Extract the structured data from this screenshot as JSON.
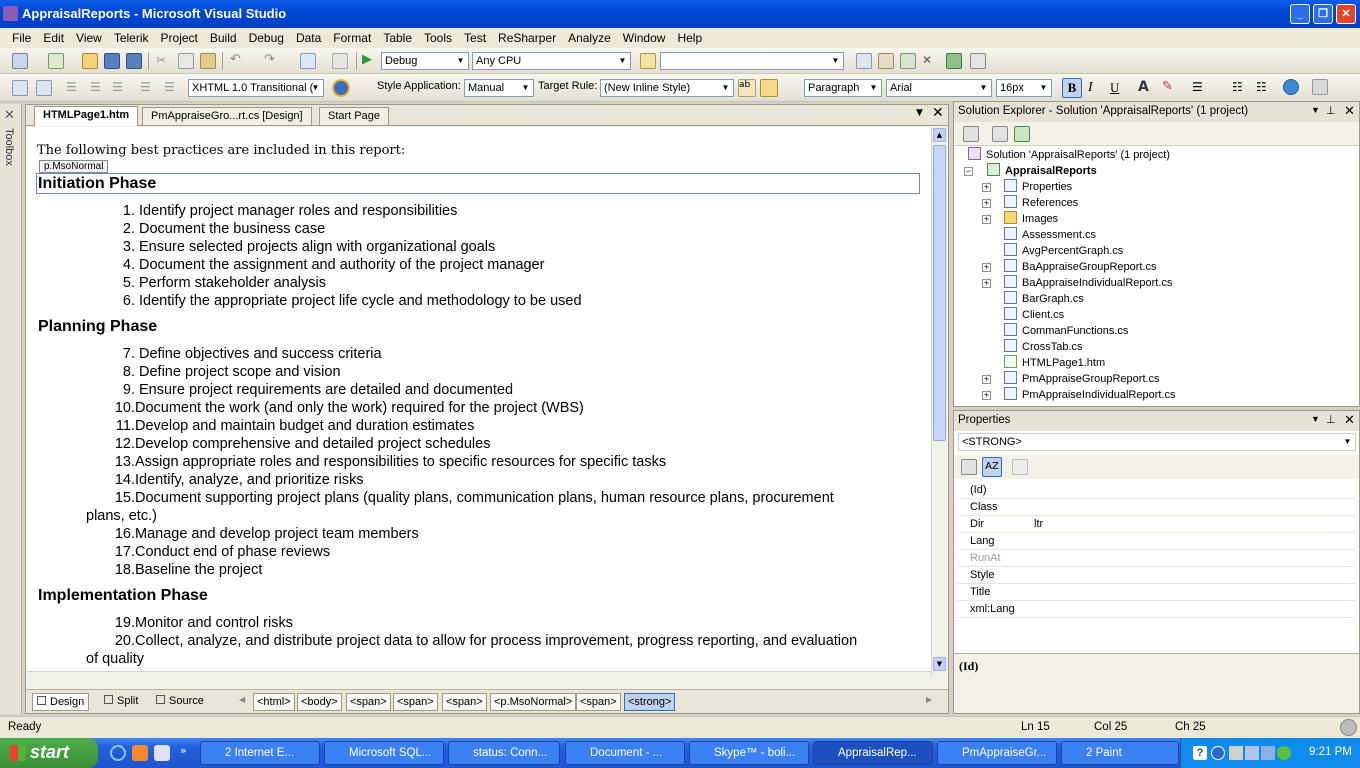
{
  "window": {
    "title": "AppraisalReports - Microsoft Visual Studio"
  },
  "menu": [
    "File",
    "Edit",
    "View",
    "Telerik",
    "Project",
    "Build",
    "Debug",
    "Data",
    "Format",
    "Table",
    "Tools",
    "Test",
    "ReSharper",
    "Analyze",
    "Window",
    "Help"
  ],
  "toolbar1": {
    "config": "Debug",
    "platform": "Any CPU",
    "find": ""
  },
  "toolbar2": {
    "doctype": "XHTML 1.0 Transitional (",
    "style_app_label": "Style Application:",
    "style_app_value": "Manual",
    "target_rule_label": "Target Rule:",
    "target_rule_value": "(New Inline Style)",
    "block_format": "Paragraph",
    "font_name": "Arial",
    "font_size": "16px"
  },
  "toolbox_label": "Toolbox",
  "tabs": [
    "HTMLPage1.htm",
    "PmAppraiseGro...rt.cs [Design]",
    "Start Page"
  ],
  "editor": {
    "intro": "The following best practices are included in this report:",
    "tag_hint": "p.MsoNormal",
    "sections": [
      {
        "heading": "Initiation Phase",
        "items": [
          {
            "n": "1.",
            "text": "Identify project manager roles and responsibilities"
          },
          {
            "n": "2.",
            "text": "Document the business case"
          },
          {
            "n": "3.",
            "text": "Ensure selected projects align with organizational goals"
          },
          {
            "n": "4.",
            "text": "Document the assignment and authority of the project manager"
          },
          {
            "n": "5.",
            "text": "Perform stakeholder analysis"
          },
          {
            "n": "6.",
            "text": "Identify the appropriate project life cycle and methodology to be used"
          }
        ]
      },
      {
        "heading": "Planning Phase",
        "items": [
          {
            "n": "7.",
            "text": "Define objectives and success criteria"
          },
          {
            "n": "8.",
            "text": "Define project scope and vision"
          },
          {
            "n": "9.",
            "text": "Ensure project requirements are detailed and documented"
          },
          {
            "n": "10.",
            "text": "Document the work (and only the work) required for the project (WBS)"
          },
          {
            "n": "11.",
            "text": "Develop and maintain budget and duration estimates"
          },
          {
            "n": "12.",
            "text": "Develop comprehensive and detailed project schedules"
          },
          {
            "n": "13.",
            "text": "Assign appropriate roles and responsibilities to specific resources for specific tasks"
          },
          {
            "n": "14.",
            "text": "Identify, analyze, and prioritize risks"
          },
          {
            "n": "15.",
            "text": "Document supporting project plans (quality plans, communication plans, human resource plans, procurement",
            "cont": "plans, etc.)"
          },
          {
            "n": "16.",
            "text": "Manage and develop project team members"
          },
          {
            "n": "17.",
            "text": "Conduct end of phase reviews"
          },
          {
            "n": "18.",
            "text": "Baseline the project"
          }
        ]
      },
      {
        "heading": "Implementation Phase",
        "items": [
          {
            "n": "19.",
            "text": "Monitor and control risks"
          },
          {
            "n": "20.",
            "text": "Collect, analyze, and distribute project data to allow for process improvement, progress reporting, and evaluation",
            "cont": "of quality"
          }
        ]
      }
    ]
  },
  "view_buttons": [
    "Design",
    "Split",
    "Source"
  ],
  "tag_path": [
    "<html>",
    "<body>",
    "<span>",
    "<span>",
    "<span>",
    "<p.MsoNormal>",
    "<span>",
    "<strong>"
  ],
  "solution_explorer": {
    "title": "Solution Explorer - Solution 'AppraisalReports' (1 project)",
    "solution": "Solution 'AppraisalReports' (1 project)",
    "project": "AppraisalReports",
    "items": [
      "Properties",
      "References",
      "Images",
      "Assessment.cs",
      "AvgPercentGraph.cs",
      "BaAppraiseGroupReport.cs",
      "BaAppraiseIndividualReport.cs",
      "BarGraph.cs",
      "Client.cs",
      "CommanFunctions.cs",
      "CrossTab.cs",
      "HTMLPage1.htm",
      "PmAppraiseGroupReport.cs",
      "PmAppraiseIndividualReport.cs"
    ]
  },
  "properties": {
    "title": "Properties",
    "object": "<STRONG>",
    "rows": [
      {
        "name": "(Id)",
        "value": ""
      },
      {
        "name": "Class",
        "value": ""
      },
      {
        "name": "Dir",
        "value": "ltr"
      },
      {
        "name": "Lang",
        "value": ""
      },
      {
        "name": "RunAt",
        "value": ""
      },
      {
        "name": "Style",
        "value": ""
      },
      {
        "name": "Title",
        "value": ""
      },
      {
        "name": "xml:Lang",
        "value": ""
      }
    ],
    "description": "(Id)"
  },
  "status": {
    "ready": "Ready",
    "ln": "Ln 15",
    "col": "Col 25",
    "ch": "Ch 25"
  },
  "taskbar": {
    "start": "start",
    "tasks": [
      "2 Internet E...",
      "Microsoft SQL...",
      "status: Conn...",
      "Document - ...",
      "Skype™ - boli...",
      "AppraisalRep...",
      "PmAppraiseGr...",
      "2 Paint"
    ],
    "clock": "9:21 PM"
  }
}
